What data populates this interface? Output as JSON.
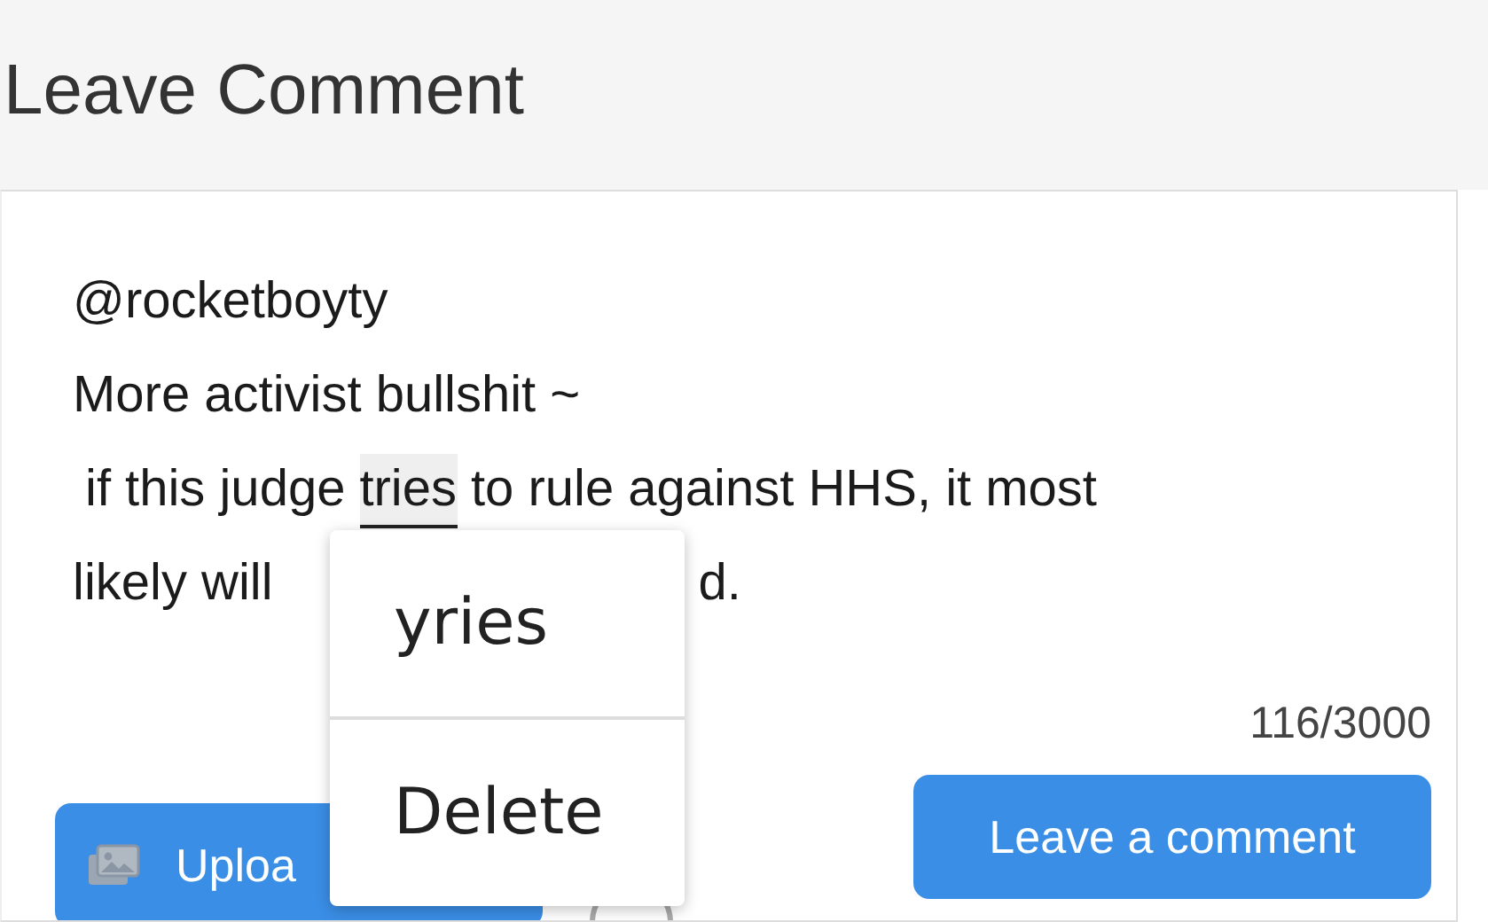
{
  "header": {
    "title": "Leave Comment"
  },
  "comment": {
    "lines": [
      [
        {
          "text": "@rocketboyty",
          "kind": "text"
        }
      ],
      [
        {
          "text": "More activist bullshit ~",
          "kind": "text"
        }
      ],
      [
        {
          "text": "if this judge",
          "kind": "text"
        },
        {
          "text": "tries",
          "kind": "highlight"
        },
        {
          "text": "to rule against HHS, it most",
          "kind": "text"
        }
      ],
      [
        {
          "text": "likely will",
          "kind": "text"
        },
        {
          "text": "d.",
          "kind": "after-popup"
        }
      ]
    ],
    "counter": "116/3000"
  },
  "buttons": [
    {
      "label": "Uploa",
      "kind": "upload"
    },
    {
      "label": "Leave a comment",
      "kind": "submit"
    }
  ],
  "popup": {
    "items": [
      "yries",
      "Delete"
    ]
  }
}
